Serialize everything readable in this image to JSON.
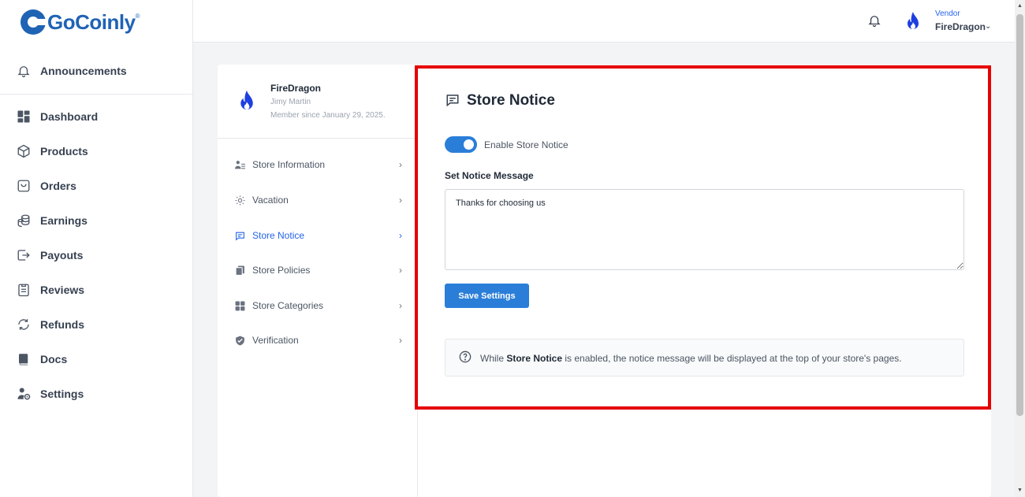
{
  "brand": {
    "name": "GoCoinly",
    "registered": "®",
    "color": "#1f63b5"
  },
  "sidebar": {
    "items": [
      {
        "label": "Announcements",
        "icon": "bell-icon"
      },
      {
        "label": "Dashboard",
        "icon": "dashboard-icon"
      },
      {
        "label": "Products",
        "icon": "box-icon"
      },
      {
        "label": "Orders",
        "icon": "bag-icon"
      },
      {
        "label": "Earnings",
        "icon": "coins-icon"
      },
      {
        "label": "Payouts",
        "icon": "payout-icon"
      },
      {
        "label": "Reviews",
        "icon": "clipboard-icon"
      },
      {
        "label": "Refunds",
        "icon": "refresh-icon"
      },
      {
        "label": "Docs",
        "icon": "book-icon"
      },
      {
        "label": "Settings",
        "icon": "user-gear-icon"
      }
    ]
  },
  "header": {
    "notifications_icon": "bell-icon",
    "vendor_role": "Vendor",
    "vendor_name": "FireDragon",
    "dropdown_icon": "chevron-down-icon"
  },
  "profile": {
    "store_name": "FireDragon",
    "owner": "Jimy Martin",
    "member_since": "Member since January 29, 2025."
  },
  "settings_menu": {
    "items": [
      {
        "label": "Store Information",
        "icon": "store-info-icon",
        "active": false
      },
      {
        "label": "Vacation",
        "icon": "sun-icon",
        "active": false
      },
      {
        "label": "Store Notice",
        "icon": "message-icon",
        "active": true
      },
      {
        "label": "Store Policies",
        "icon": "documents-icon",
        "active": false
      },
      {
        "label": "Store Categories",
        "icon": "grid-icon",
        "active": false
      },
      {
        "label": "Verification",
        "icon": "shield-icon",
        "active": false
      }
    ],
    "chevron": "›"
  },
  "store_notice": {
    "title": "Store Notice",
    "enabled": true,
    "toggle_label": "Enable Store Notice",
    "message_label": "Set Notice Message",
    "message_value": "Thanks for choosing us",
    "save_label": "Save Settings",
    "info_prefix": "While ",
    "info_bold": "Store Notice",
    "info_suffix": " is enabled, the notice message will be displayed at the top of your store's pages."
  },
  "colors": {
    "accent": "#2a7ed8",
    "active_link": "#2563eb",
    "highlight_border": "#e60000"
  }
}
